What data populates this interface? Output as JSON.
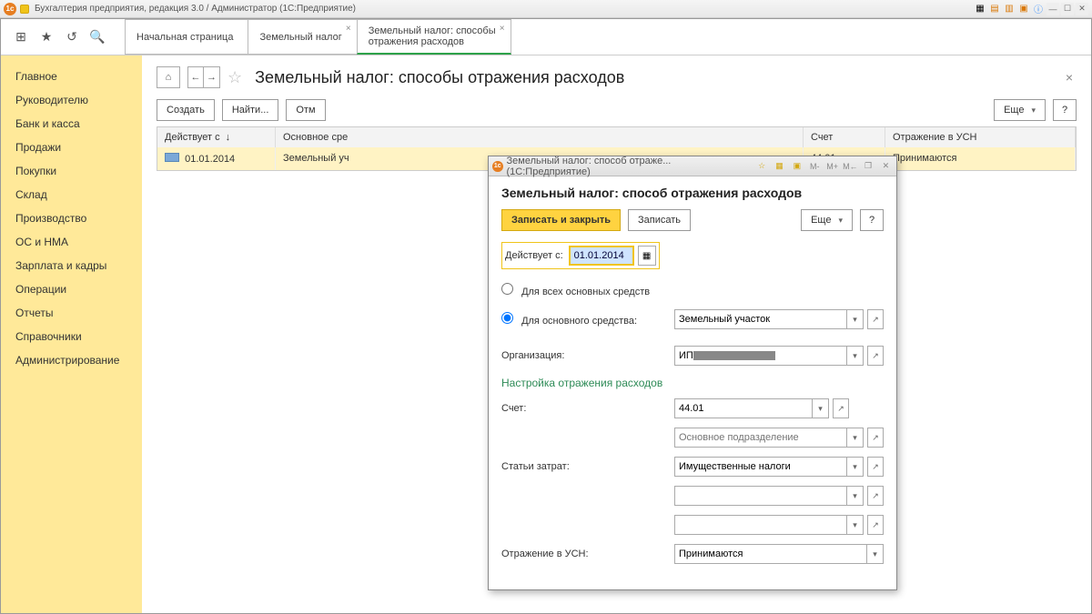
{
  "window": {
    "title": "Бухгалтерия предприятия, редакция 3.0 / Администратор  (1С:Предприятие)"
  },
  "tabs": {
    "t0": "Начальная страница",
    "t1": "Земельный налог",
    "t2_a": "Земельный налог: способы",
    "t2_b": "отражения расходов"
  },
  "sidebar": {
    "items": [
      "Главное",
      "Руководителю",
      "Банк и касса",
      "Продажи",
      "Покупки",
      "Склад",
      "Производство",
      "ОС и НМА",
      "Зарплата и кадры",
      "Операции",
      "Отчеты",
      "Справочники",
      "Администрирование"
    ]
  },
  "page": {
    "title": "Земельный налог: способы отражения расходов",
    "create": "Создать",
    "find": "Найти...",
    "cancel": "Отм",
    "more": "Еще",
    "q": "?",
    "headers": {
      "date": "Действует с",
      "asset": "Основное сре",
      "acct": "Счет",
      "usn": "Отражение в УСН"
    },
    "row": {
      "date": "01.01.2014",
      "asset": "Земельный уч",
      "acct": "44.01",
      "usn": "Принимаются"
    }
  },
  "dialog": {
    "wintitle": "Земельный налог: способ отраже...  (1С:Предприятие)",
    "title": "Земельный налог: способ отражения расходов",
    "save_close": "Записать и закрыть",
    "save": "Записать",
    "more": "Еще",
    "q": "?",
    "eff_from": "Действует с:",
    "eff_date": "01.01.2014",
    "radio_all": "Для всех основных средств",
    "radio_one": "Для основного средства:",
    "asset": "Земельный участок",
    "org_lbl": "Организация:",
    "org_prefix": "ИП ",
    "section": "Настройка отражения расходов",
    "acct_lbl": "Счет:",
    "acct": "44.01",
    "dept_ph": "Основное подразделение",
    "cost_lbl": "Статьи затрат:",
    "cost": "Имущественные налоги",
    "usn_lbl": "Отражение в УСН:",
    "usn": "Принимаются"
  }
}
